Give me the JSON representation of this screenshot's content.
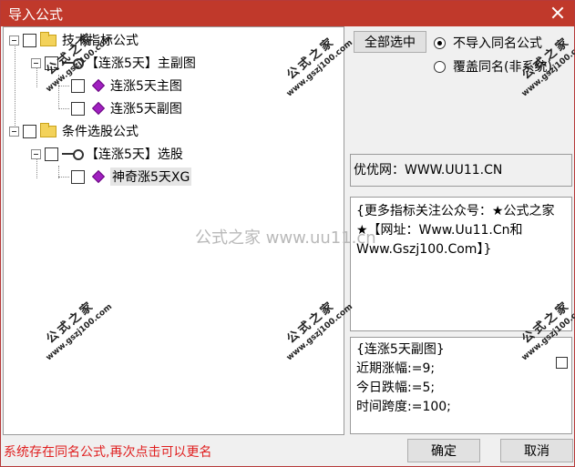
{
  "window": {
    "title": "导入公式"
  },
  "tree": {
    "group1": {
      "label": "技术指标公式",
      "child": {
        "label": "【连涨5天】主副图",
        "items": [
          "连涨5天主图",
          "连涨5天副图"
        ]
      }
    },
    "group2": {
      "label": "条件选股公式",
      "child": {
        "label": "【连涨5天】选股",
        "items": [
          "神奇涨5天XG"
        ]
      }
    }
  },
  "right": {
    "select_all_label": "全部选中",
    "radio_no_import": "不导入同名公式",
    "radio_overwrite": "覆盖同名(非系统)",
    "site_info": "优优网：WWW.UU11.CN",
    "promo_text": "{更多指标关注公众号：★公式之家★【网址：Www.Uu11.Cn和Www.Gszj100.Com】}",
    "params_lines": [
      "{连涨5天副图}",
      "近期涨幅:=9;",
      "今日跌幅:=5;",
      "时间跨度:=100;"
    ]
  },
  "status": {
    "message": "系统存在同名公式,再次点击可以更名"
  },
  "buttons": {
    "ok_label": "确定",
    "cancel_label": "取消"
  },
  "watermark": {
    "brand": "公式之家",
    "url": "www.gszj100.com",
    "center": "公式之家 www.uu11.cn"
  }
}
